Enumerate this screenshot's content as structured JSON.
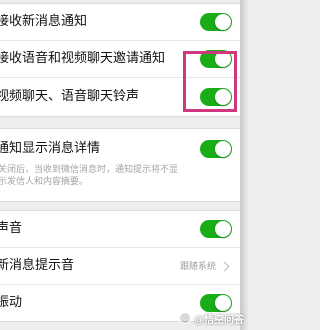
{
  "settings": {
    "group1": {
      "rows": [
        {
          "label": "接收新消息通知",
          "toggle_on": true
        },
        {
          "label": "接收语音和视频聊天邀请通知",
          "toggle_on": true
        },
        {
          "label": "视频聊天、语音聊天铃声",
          "toggle_on": true
        }
      ]
    },
    "group2": {
      "label": "通知显示消息详情",
      "toggle_on": true,
      "description": "关闭后，当收到微信消息时，通知提示将不显示发信人和内容摘要。"
    },
    "group3": {
      "sound": {
        "label": "声音",
        "toggle_on": true
      },
      "new_message_tone": {
        "label": "新消息提示音",
        "value": "跟随系统"
      },
      "vibrate": {
        "label": "振动",
        "toggle_on": true
      }
    }
  },
  "colors": {
    "toggle_on": "#1aad19",
    "highlight": "#d0377d",
    "background": "#ededed"
  },
  "watermark": {
    "text": "@悟空问答",
    "icon": "wukong-logo-icon"
  }
}
